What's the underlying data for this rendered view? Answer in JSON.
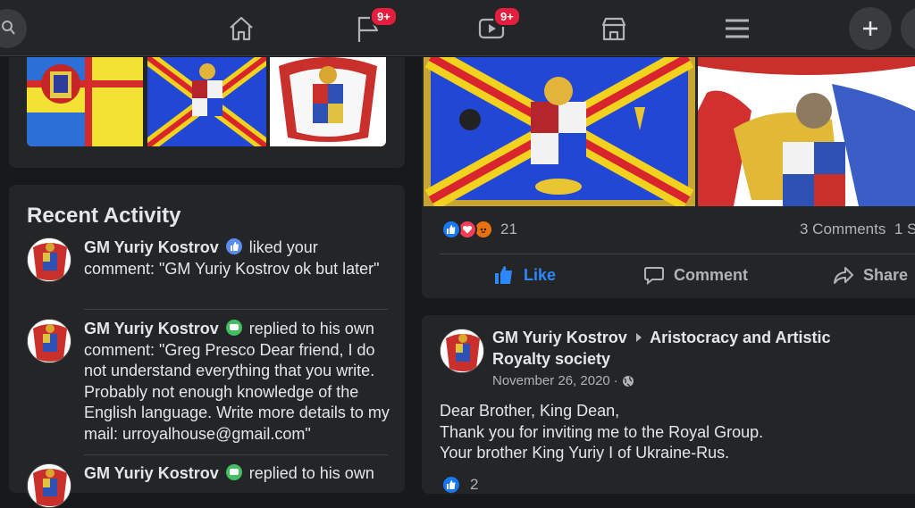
{
  "nav": {
    "icons": [
      "search-icon",
      "home-icon",
      "flag-icon",
      "watch-icon",
      "marketplace-icon",
      "menu-icon",
      "create-icon"
    ],
    "pages_badge": "9+",
    "watch_badge": "9+"
  },
  "colors": {
    "background": "#18191a",
    "card": "#242526",
    "accent_blue": "#2d88ff",
    "badge_red": "#e41e3f",
    "text_primary": "#e4e6eb",
    "text_secondary": "#b0b3b8"
  },
  "recent_activity": {
    "title": "Recent Activity",
    "items": [
      {
        "name": "GM Yuriy Kostrov",
        "action_icon": "like-icon",
        "text": "liked your comment: \"GM Yuriy Kostrov ok but later\""
      },
      {
        "name": "GM Yuriy Kostrov",
        "action_icon": "comment-icon",
        "text": "replied to his own comment: \"Greg Presco Dear friend, I do not understand everything that you write. Probably not enough knowledge of the English language. Write more details to my mail: urroyalhouse@gmail.com\""
      },
      {
        "name": "GM Yuriy Kostrov",
        "action_icon": "comment-icon",
        "text": "replied to his own"
      }
    ]
  },
  "post1": {
    "reaction_count": "21",
    "comments_text": "3 Comments",
    "shares_partial": "1 S",
    "actions": {
      "like": "Like",
      "comment": "Comment",
      "share": "Share"
    }
  },
  "post2": {
    "author": "GM Yuriy Kostrov",
    "group": "Aristocracy and Artistic Royalty society",
    "date": "November 26, 2020",
    "date_separator": "·",
    "privacy_icon": "globe-icon",
    "body": [
      "Dear Brother, King Dean,",
      "Thank you for inviting me to the Royal Group.",
      "Your brother King Yuriy I of Ukraine-Rus."
    ],
    "reaction_count_partial": "2"
  }
}
